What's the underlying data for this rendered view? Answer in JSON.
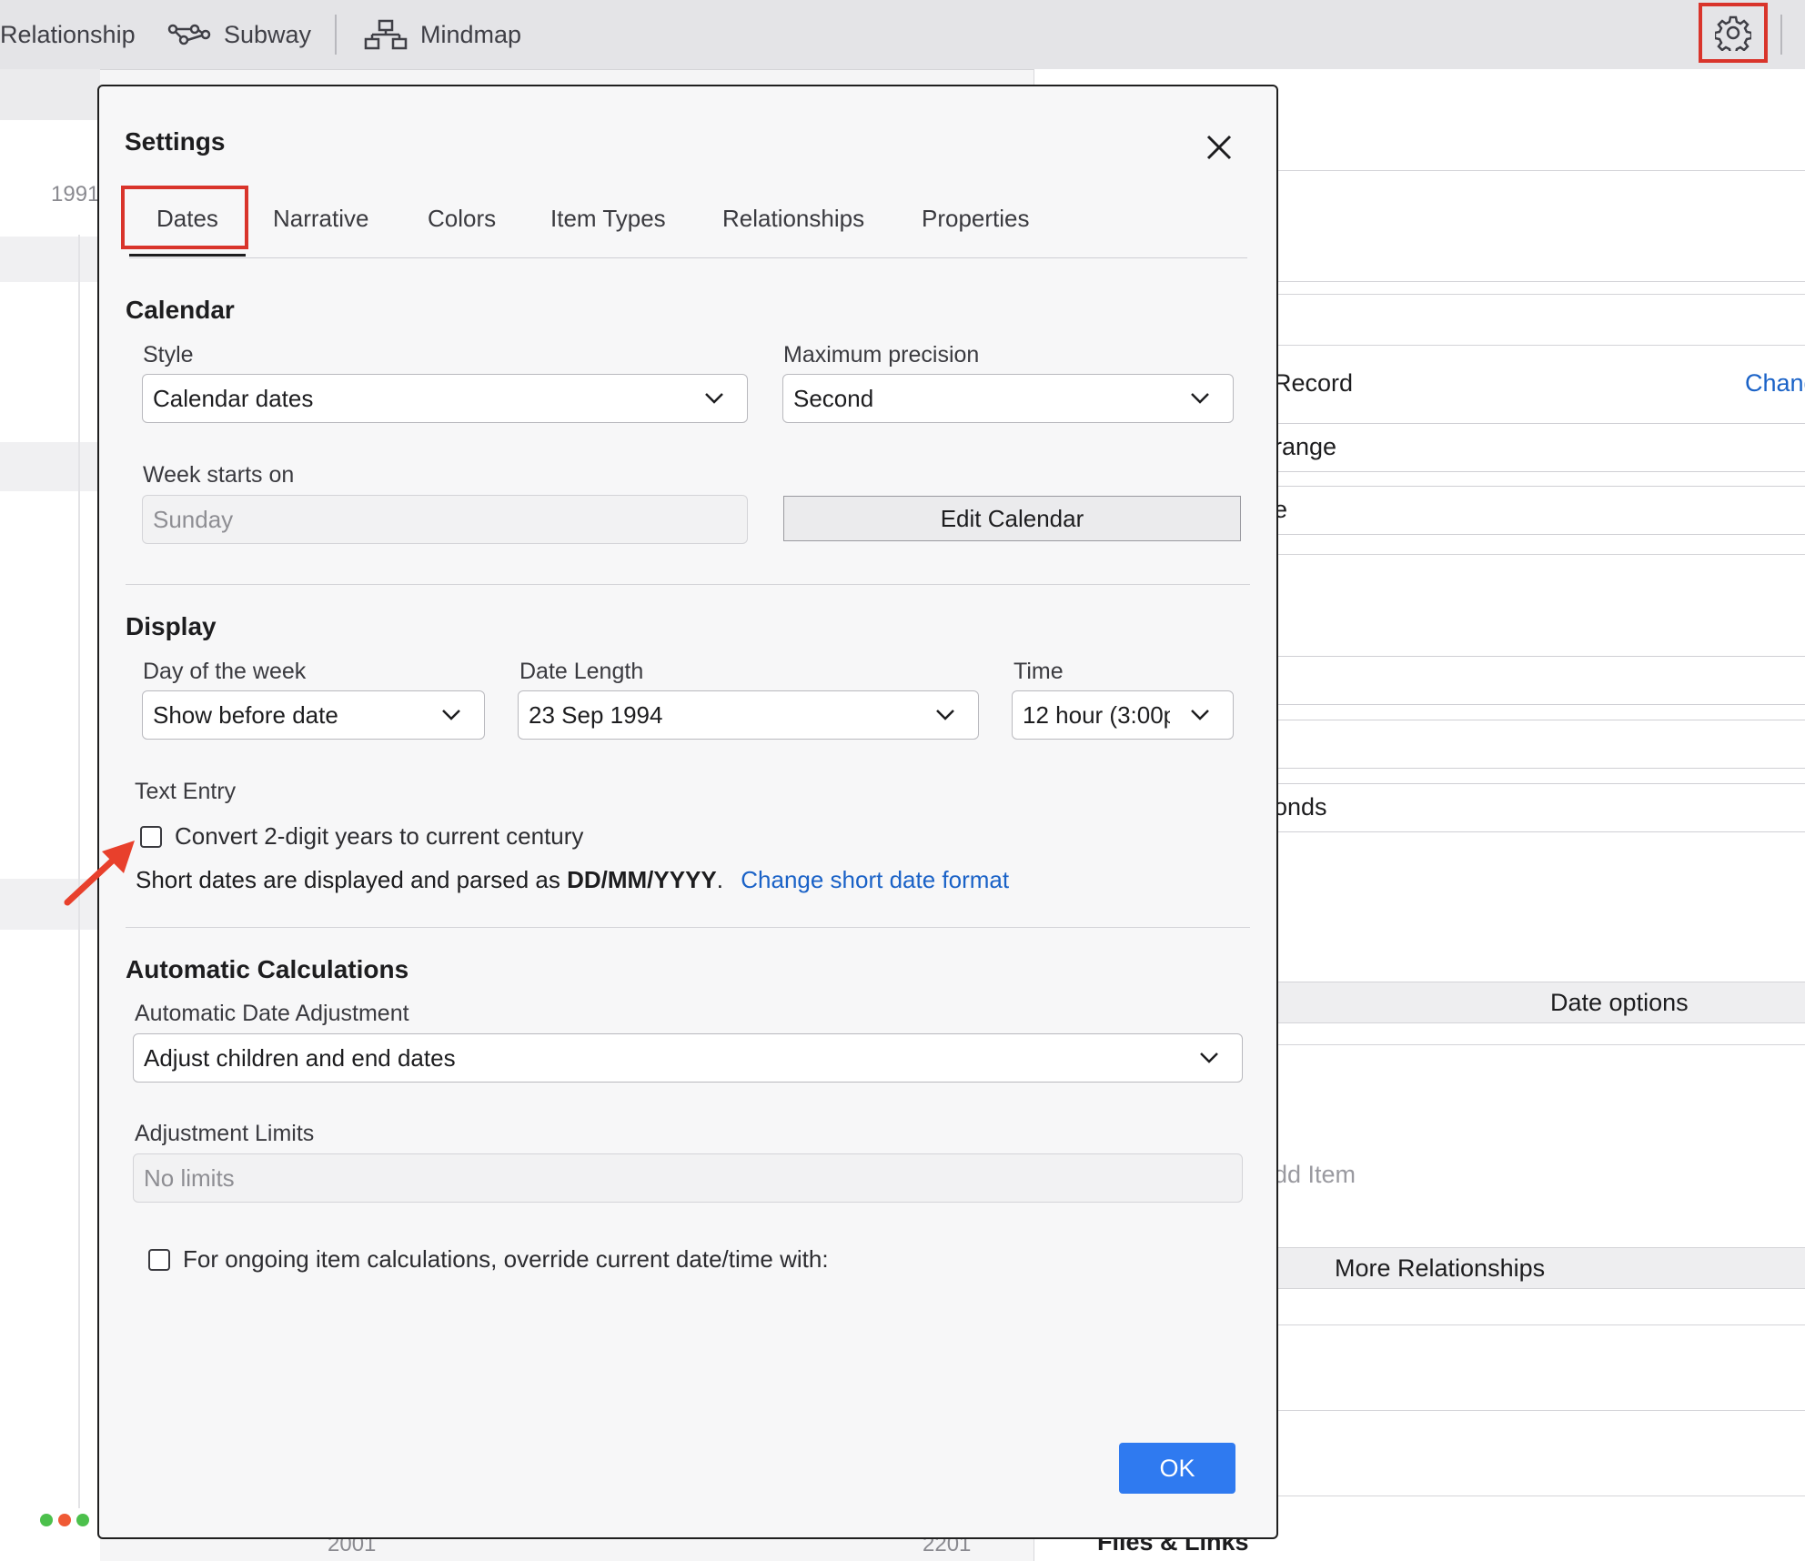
{
  "toolbar": {
    "relationship_label": "Relationship",
    "subway_label": "Subway",
    "mindmap_label": "Mindmap"
  },
  "background": {
    "year_top": "1991",
    "year_bottom_left": "2001",
    "year_bottom_right": "2201",
    "right_panel": {
      "record_label": "Record",
      "change_link": "Chang",
      "range_value": "range",
      "field2_value": "e",
      "seconds_value": "onds",
      "date_options": "Date options",
      "add_item": "dd Item",
      "more_relationships": "More Relationships",
      "files_links": "Files & Links"
    }
  },
  "dialog": {
    "title": "Settings",
    "tabs": [
      "Dates",
      "Narrative",
      "Colors",
      "Item Types",
      "Relationships",
      "Properties"
    ],
    "active_tab": "Dates",
    "calendar": {
      "title": "Calendar",
      "style_label": "Style",
      "style_value": "Calendar dates",
      "precision_label": "Maximum precision",
      "precision_value": "Second",
      "week_label": "Week starts on",
      "week_value": "Sunday",
      "edit_calendar": "Edit Calendar"
    },
    "display": {
      "title": "Display",
      "day_label": "Day of the week",
      "day_value": "Show before date",
      "length_label": "Date Length",
      "length_value": "23 Sep 1994",
      "time_label": "Time",
      "time_value": "12 hour (3:00p",
      "text_entry_label": "Text Entry",
      "convert_label": "Convert 2-digit years to current century",
      "convert_checked": false,
      "short_dates_prefix": "Short dates are displayed and parsed as ",
      "short_dates_format": "DD/MM/YYYY",
      "short_dates_suffix": ".",
      "change_format_link": "Change short date format"
    },
    "automatic": {
      "title": "Automatic Calculations",
      "adjust_label": "Automatic Date Adjustment",
      "adjust_value": "Adjust children and end dates",
      "limits_label": "Adjustment Limits",
      "limits_value": "No limits",
      "override_label": "For ongoing item calculations, override current date/time with:",
      "override_checked": false
    },
    "ok_label": "OK"
  },
  "colors": {
    "accent": "#2f7af0",
    "highlight": "#d9342b",
    "link": "#1a62c7"
  }
}
